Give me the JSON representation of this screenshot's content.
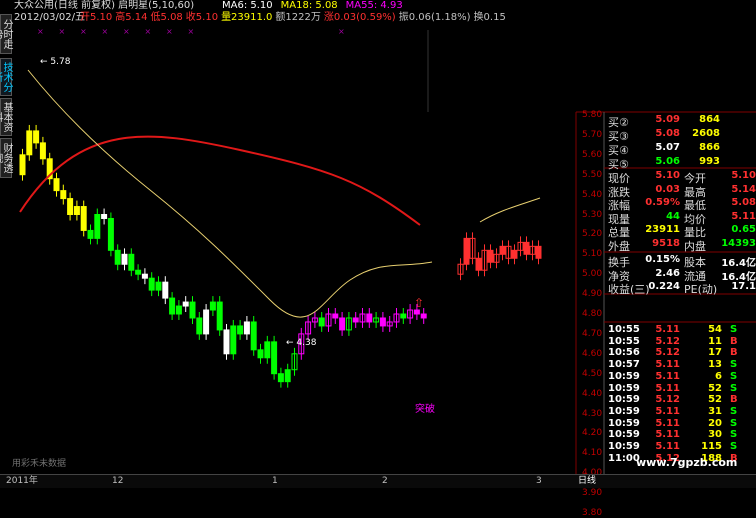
{
  "header": {
    "stock_line": "大众公用(日线 前复权) 启明星(5,10,60)",
    "ma_labels": [
      {
        "text": "MA6: 5.10",
        "color": "#ffffff"
      },
      {
        "text": "MA18: 5.08",
        "color": "#ffff00"
      },
      {
        "text": "MA55: 4.93",
        "color": "#ff00ff"
      }
    ],
    "date": "2012/03/02/五",
    "quote_fields": [
      {
        "text": "开5.10",
        "color": "#ff3030"
      },
      {
        "text": "高5.14",
        "color": "#ff3030"
      },
      {
        "text": "低5.08",
        "color": "#ff3030"
      },
      {
        "text": "收5.10",
        "color": "#ff3030"
      },
      {
        "text": "量23911.0",
        "color": "#ffff00"
      },
      {
        "text": "额1222万",
        "color": "#c0c0c0"
      },
      {
        "text": "涨0.03(0.59%)",
        "color": "#ff3030"
      },
      {
        "text": "振0.06(1.18%)",
        "color": "#c0c0c0"
      },
      {
        "text": "换0.15",
        "color": "#c0c0c0"
      }
    ]
  },
  "sidebar_tabs": [
    {
      "label": "分时走势",
      "active": false
    },
    {
      "label": "技术分析",
      "active": true
    },
    {
      "label": "基本资料",
      "active": false
    },
    {
      "label": "财务透视",
      "active": false
    }
  ],
  "annotations": {
    "high_label": "5.78",
    "low_label": "4.38",
    "breakout_label": "突破",
    "watermark": "用彩禾未数据"
  },
  "price_axis": [
    "5.80",
    "5.70",
    "5.60",
    "5.50",
    "5.40",
    "5.30",
    "5.20",
    "5.10",
    "5.00",
    "4.90",
    "4.80",
    "4.70",
    "4.60",
    "4.50",
    "4.40",
    "4.30",
    "4.20",
    "4.10",
    "4.00",
    "3.90",
    "3.80"
  ],
  "time_axis": {
    "labels": [
      "2011年",
      "12",
      "1",
      "2",
      "3"
    ],
    "period": "日线"
  },
  "order_book": [
    {
      "label": "买②",
      "price": "5.09",
      "vol": "864",
      "price_color": "#ff3030"
    },
    {
      "label": "买③",
      "price": "5.08",
      "vol": "2608",
      "price_color": "#ff3030"
    },
    {
      "label": "买④",
      "price": "5.07",
      "vol": "866",
      "price_color": "#ffffff"
    },
    {
      "label": "买⑤",
      "price": "5.06",
      "vol": "993",
      "price_color": "#00ff00"
    }
  ],
  "quote_table": [
    {
      "l1": "现价",
      "v1": "5.10",
      "c1": "#ff3030",
      "l2": "今开",
      "v2": "5.10",
      "c2": "#ff3030"
    },
    {
      "l1": "涨跌",
      "v1": "0.03",
      "c1": "#ff3030",
      "l2": "最高",
      "v2": "5.14",
      "c2": "#ff3030"
    },
    {
      "l1": "涨幅",
      "v1": "0.59%",
      "c1": "#ff3030",
      "l2": "最低",
      "v2": "5.08",
      "c2": "#ff3030"
    },
    {
      "l1": "现量",
      "v1": "44",
      "c1": "#00ff00",
      "l2": "均价",
      "v2": "5.11",
      "c2": "#ff3030"
    },
    {
      "l1": "总量",
      "v1": "23911",
      "c1": "#ffff00",
      "l2": "量比",
      "v2": "0.65",
      "c2": "#00ff00"
    },
    {
      "l1": "外盘",
      "v1": "9518",
      "c1": "#ff3030",
      "l2": "内盘",
      "v2": "14393",
      "c2": "#00ff00"
    }
  ],
  "fundamentals": [
    {
      "l1": "换手",
      "v1": "0.15%",
      "l2": "股本",
      "v2": "16.4亿"
    },
    {
      "l1": "净资",
      "v1": "2.46",
      "l2": "流通",
      "v2": "16.4亿"
    },
    {
      "l1": "收益(三)",
      "v1": "0.224",
      "l2": "PE(动)",
      "v2": "17.1"
    }
  ],
  "ticks": [
    {
      "time": "10:55",
      "price": "5.11",
      "vol": "54",
      "side": "S"
    },
    {
      "time": "10:55",
      "price": "5.12",
      "vol": "11",
      "side": "B"
    },
    {
      "time": "10:56",
      "price": "5.12",
      "vol": "17",
      "side": "B"
    },
    {
      "time": "10:57",
      "price": "5.11",
      "vol": "13",
      "side": "S"
    },
    {
      "time": "10:59",
      "price": "5.11",
      "vol": "6",
      "side": "S"
    },
    {
      "time": "10:59",
      "price": "5.11",
      "vol": "52",
      "side": "S"
    },
    {
      "time": "10:59",
      "price": "5.12",
      "vol": "52",
      "side": "B"
    },
    {
      "time": "10:59",
      "price": "5.11",
      "vol": "31",
      "side": "S"
    },
    {
      "time": "10:59",
      "price": "5.11",
      "vol": "20",
      "side": "S"
    },
    {
      "time": "10:59",
      "price": "5.11",
      "vol": "30",
      "side": "S"
    },
    {
      "time": "10:59",
      "price": "5.11",
      "vol": "115",
      "side": "S"
    },
    {
      "time": "11:00",
      "price": "5.12",
      "vol": "188",
      "side": "B"
    }
  ],
  "site_watermark": "www.7gpzb.com",
  "colors": {
    "up": "#ff3030",
    "down": "#00ff00",
    "ma55": "#e01818",
    "ma18": "#e8d070",
    "grid": "#800000"
  }
}
